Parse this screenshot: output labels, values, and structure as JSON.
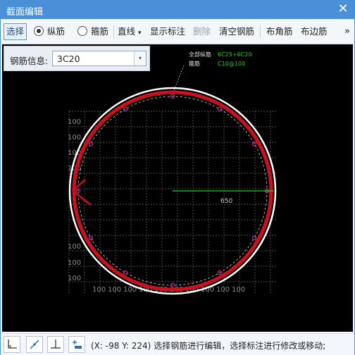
{
  "window": {
    "title": "截面编辑",
    "close_glyph": "✕"
  },
  "toolbar": {
    "select_label": "选择",
    "longitudinal_label": "纵筋",
    "stirrup_label": "箍筋",
    "line_label": "直线",
    "line_dropdown_glyph": "▾",
    "show_dim_label": "显示标注",
    "delete_label": "删除",
    "clear_label": "清空钢筋",
    "corner_label": "布角筋",
    "edge_label": "布边筋",
    "more_glyph": "»",
    "selected_radio": "longitudinal"
  },
  "info_panel": {
    "label": "钢筋信息:",
    "value": "3C20",
    "arrow_glyph": "▾"
  },
  "drawing": {
    "legend": {
      "all_long_label": "全部纵筋",
      "all_long_value": "6C25+6C20",
      "stirrup_label": "箍筋",
      "stirrup_value": "C10@100"
    },
    "radius_dim": "650",
    "grid_label": "100",
    "colors": {
      "circle": "#ffffff",
      "stirrup": "#cc1020",
      "bar": "#c02090",
      "dim": "#22cc22",
      "grid": "#6a6a6a",
      "legend_value": "#22cc22"
    }
  },
  "status": {
    "coords": "(X: -98 Y: 224)",
    "hint": "选择钢筋进行编辑，选择标注进行修改或移动;"
  }
}
